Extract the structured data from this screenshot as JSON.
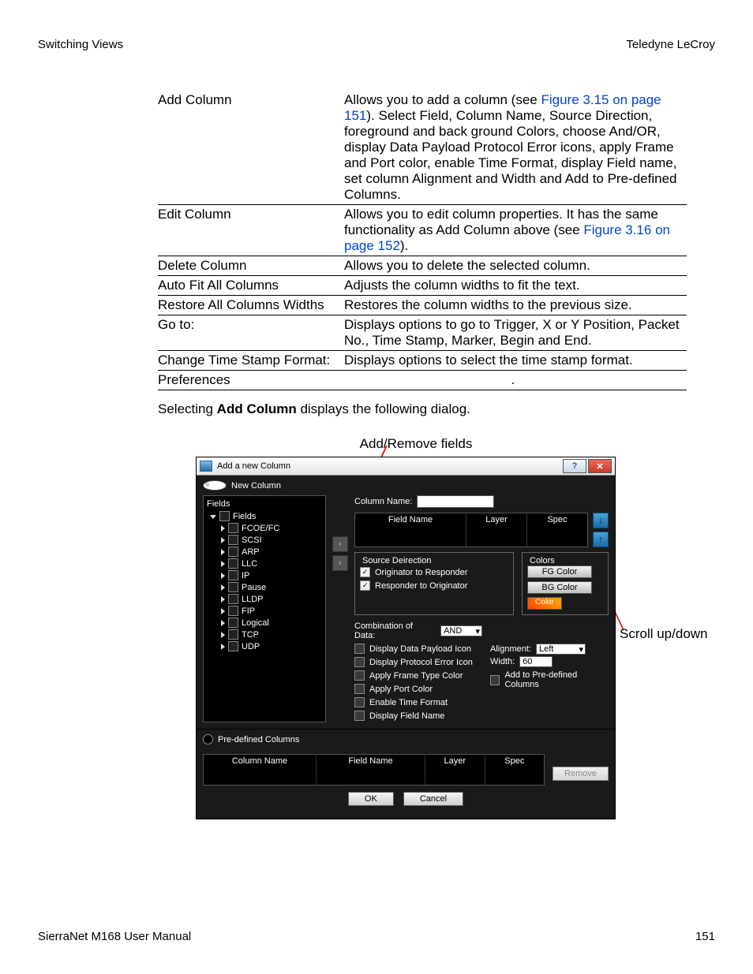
{
  "header": {
    "left": "Switching Views",
    "right": "Teledyne LeCroy"
  },
  "table": [
    {
      "term": "Add Column",
      "desc_pre": "Allows you to add a column (see ",
      "link": "Figure 3.15 on page 151",
      "desc_post": "). Select Field, Column Name, Source Direction, foreground and back ground Colors, choose And/OR, display Data Payload Protocol Error icons, apply Frame and Port color, enable Time Format, display Field name, set column Alignment and Width and Add to Pre-defined Columns."
    },
    {
      "term": "Edit Column",
      "desc_pre": "Allows you to edit column properties. It has the same functionality as Add Column above (see ",
      "link": "Figure 3.16 on page 152",
      "desc_post": ")."
    },
    {
      "term": "Delete Column",
      "desc_pre": "Allows you to delete the selected column.",
      "link": "",
      "desc_post": ""
    },
    {
      "term": "Auto Fit All Columns",
      "desc_pre": "Adjusts the column widths to fit the text.",
      "link": "",
      "desc_post": ""
    },
    {
      "term": "Restore All Columns Widths",
      "desc_pre": "Restores the column widths to the previous size.",
      "link": "",
      "desc_post": ""
    },
    {
      "term": "Go to:",
      "desc_pre": "Displays options to go to Trigger, X or Y Position, Packet No., Time Stamp, Marker, Begin and End.",
      "link": "",
      "desc_post": ""
    },
    {
      "term": "Change Time Stamp Format:",
      "desc_pre": "Displays options to select the time stamp format.",
      "link": "",
      "desc_post": ""
    },
    {
      "term": "Preferences",
      "desc_pre": " ",
      "link": "",
      "desc_post": "."
    }
  ],
  "intro": {
    "pre": "Selecting ",
    "bold": "Add Column",
    "post": " displays the following dialog."
  },
  "callouts": {
    "top": "Add/Remove fields",
    "right": "Scroll up/down"
  },
  "dialog": {
    "title": "Add a new Column",
    "radio1": "New Column",
    "fields_title": "Fields",
    "tree_root": "Fields",
    "tree": [
      "FCOE/FC",
      "SCSI",
      "ARP",
      "LLC",
      "IP",
      "Pause",
      "LLDP",
      "FIP",
      "Logical",
      "TCP",
      "UDP"
    ],
    "col_name_lbl": "Column Name:",
    "list_headers": [
      "Field Name",
      "Layer",
      "Spec"
    ],
    "src_dir": {
      "legend": "Source Deirection",
      "o2r": "Originator to Responder",
      "r2o": "Responder to Originator"
    },
    "colors": {
      "legend": "Colors",
      "fg": "FG Color",
      "bg": "BG Color",
      "swatch": "Color"
    },
    "combo_lbl": "Combination of Data:",
    "combo_val": "AND",
    "checks": [
      "Display Data Payload Icon",
      "Display Protocol Error Icon",
      "Apply Frame Type Color",
      "Apply Port Color",
      "Enable Time Format",
      "Display Field Name"
    ],
    "align_lbl": "Alignment:",
    "align_val": "Left",
    "width_lbl": "Width:",
    "width_val": "60",
    "add_predef": "Add to Pre-defined Columns",
    "radio2": "Pre-defined Columns",
    "pdc_headers": [
      "Column Name",
      "Field Name",
      "Layer",
      "Spec"
    ],
    "remove": "Remove",
    "ok": "OK",
    "cancel": "Cancel"
  },
  "footer": {
    "left": "SierraNet M168 User Manual",
    "right": "151"
  }
}
